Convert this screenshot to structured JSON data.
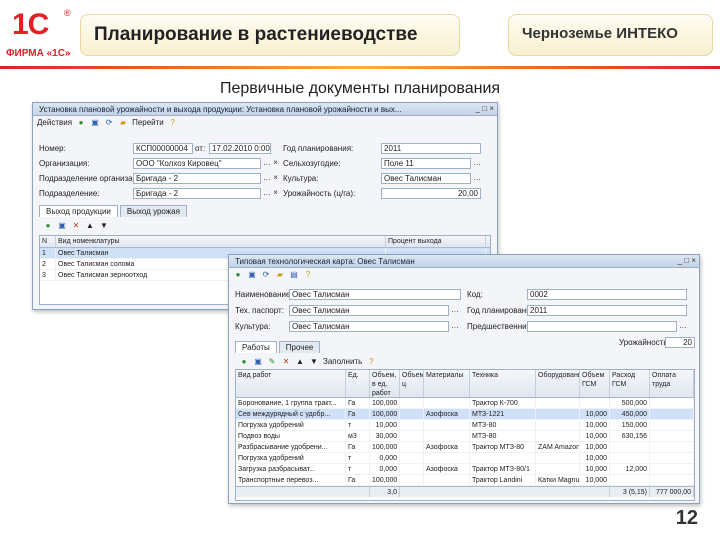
{
  "header": {
    "logo_mark": "1С",
    "logo_reg": "®",
    "logo_text": "ФИРМА «1С»",
    "title": "Планирование в растениеводстве",
    "company": "Черноземье ИНТЕКО"
  },
  "subtitle": "Первичные документы планирования",
  "page_number": "12",
  "colors": {
    "brand_red": "#e31e24",
    "accent_gold": "#f0b43a",
    "window_border": "#8ea2bd",
    "selection": "#cfe0f7"
  },
  "doc_window": {
    "title": "Установка плановой урожайности и выхода продукции: Установка плановой урожайности и вых...",
    "toolbar": {
      "actions": "Действия",
      "goto": "Перейти"
    },
    "fields": {
      "number_label": "Номер:",
      "number_value": "КСП00000004",
      "date_sep": "от:",
      "date_value": "17.02.2010 0:00:00",
      "plan_year_label": "Год планирования:",
      "plan_year_value": "2011",
      "org_label": "Организация:",
      "org_value": "ООО \"Колхоз Кировец\"",
      "field_label": "Сельхозугодие:",
      "field_value": "Поле 11",
      "dept_label": "Подразделение организации:",
      "dept_value": "Бригада - 2",
      "culture_label": "Культура:",
      "culture_value": "Овес Талисман",
      "subdiv_label": "Подразделение:",
      "subdiv_value": "Бригада - 2",
      "yield_label": "Урожайность (ц/га):",
      "yield_value": "20,00"
    },
    "tabs": [
      "Выход продукции",
      "Выход урожая"
    ],
    "grid": {
      "headers": [
        "N",
        "Вид номенклатуры",
        "Процент выхода"
      ],
      "rows": [
        {
          "n": "1",
          "name": "Овес Талисман",
          "pct": ""
        },
        {
          "n": "2",
          "name": "Овес Талисман солома",
          "pct": ""
        },
        {
          "n": "3",
          "name": "Овес Талисман зерноотход",
          "pct": ""
        }
      ]
    }
  },
  "techcard_window": {
    "title": "Типовая технологическая карта: Овес Талисман",
    "fields": {
      "name_label": "Наименование:",
      "name_value": "Овес Талисман",
      "code_label": "Код:",
      "code_value": "0002",
      "tech_label": "Тех. паспорт:",
      "tech_value": "Овес Талисман",
      "plan_year_label": "Год планирования:",
      "plan_year_value": "2011",
      "culture_label": "Культура:",
      "culture_value": "Овес Талисман",
      "pred_label": "Предшественник:",
      "pred_value": "",
      "yield_label": "Урожайность:",
      "yield_value": "20"
    },
    "tabs": [
      "Работы",
      "Прочее"
    ],
    "toolbar_actions": "Заполнить",
    "grid": {
      "headers": [
        "Вид работ",
        "Ед.",
        "Объем, в ед. работ",
        "Объем, ц",
        "Материалы",
        "Техника",
        "Оборудование",
        "Объем ГСМ",
        "Расход ГСМ",
        "Оплата труда"
      ],
      "rows": [
        {
          "work": "Боронование, 1 группа тракт...",
          "unit": "Га",
          "vol": "100,000",
          "vol_c": "",
          "mat": "",
          "tech": "Трактор К-700",
          "equip": "",
          "gsm": "",
          "rate": "500,000",
          "pay": "",
          "sel": false
        },
        {
          "work": "Сев междурядный с удобр...",
          "unit": "Га",
          "vol": "100,000",
          "vol_c": "",
          "mat": "Азофоска",
          "tech": "МТЗ-1221",
          "equip": "",
          "gsm": "10,000",
          "rate": "450,000",
          "pay": "",
          "sel": true
        },
        {
          "work": "Погрузка удобрений",
          "unit": "т",
          "vol": "10,000",
          "vol_c": "",
          "mat": "",
          "tech": "МТЗ-80",
          "equip": "",
          "gsm": "10,000",
          "rate": "150,000",
          "pay": "",
          "sel": false
        },
        {
          "work": "Подвоз воды",
          "unit": "м3",
          "vol": "30,000",
          "vol_c": "",
          "mat": "",
          "tech": "МТЗ-80",
          "equip": "",
          "gsm": "10,000",
          "rate": "630,156",
          "pay": "",
          "sel": false
        },
        {
          "work": "Разбрасывание удобрени...",
          "unit": "Га",
          "vol": "100,000",
          "vol_c": "",
          "mat": "Азофоска",
          "tech": "Трактор МТЗ-80",
          "equip": "ZAM Amazon...",
          "gsm": "10,000",
          "rate": "",
          "pay": "",
          "sel": false
        },
        {
          "work": "Погрузка удобрений",
          "unit": "т",
          "vol": "0,000",
          "vol_c": "",
          "mat": "",
          "tech": "",
          "equip": "",
          "gsm": "10,000",
          "rate": "",
          "pay": "",
          "sel": false
        },
        {
          "work": "Загрузка разбрасыват...",
          "unit": "т",
          "vol": "0,000",
          "vol_c": "",
          "mat": "Азофоска",
          "tech": "Трактор МТЗ-80/1",
          "equip": "",
          "gsm": "10,000",
          "rate": "12,000",
          "pay": "",
          "sel": false
        },
        {
          "work": "Транспортные перевоз...",
          "unit": "Га",
          "vol": "100,000",
          "vol_c": "",
          "mat": "",
          "tech": "Трактор Landini",
          "equip": "Катки Magnum",
          "gsm": "10,000",
          "rate": "",
          "pay": "",
          "sel": false
        }
      ],
      "totals": {
        "vol": "3,0",
        "rate": "3 (5,15)",
        "pay": "777 000,00"
      }
    }
  }
}
